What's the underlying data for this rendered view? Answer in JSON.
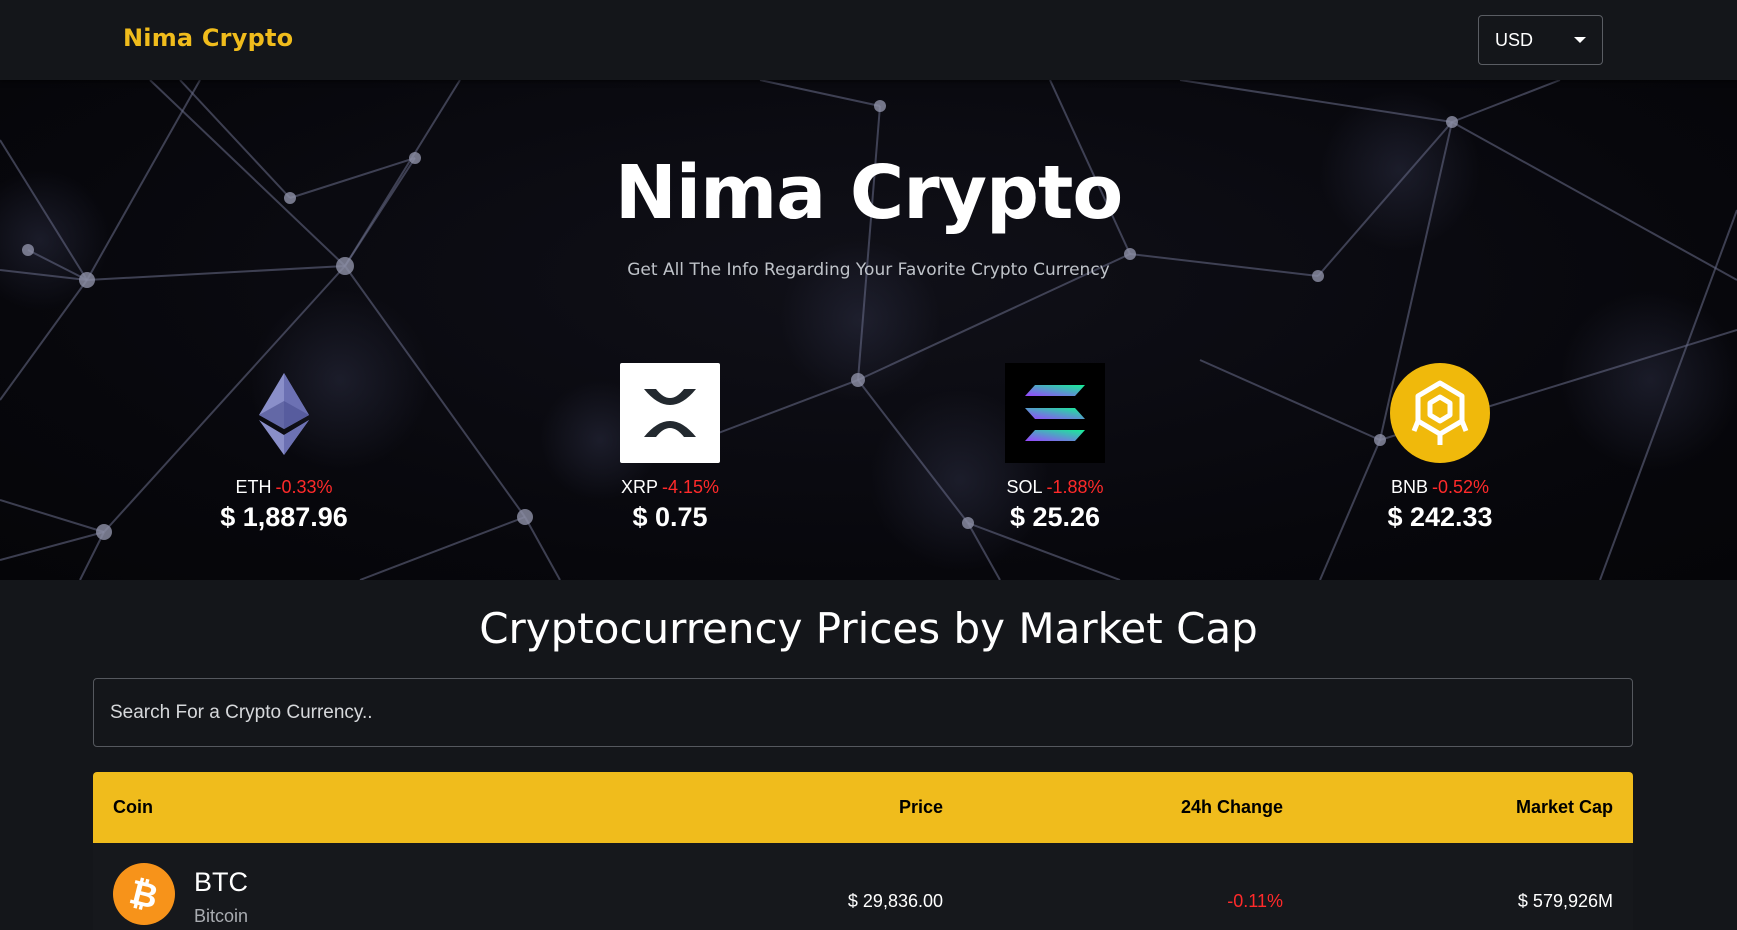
{
  "header": {
    "brand": "Nima Crypto",
    "currency": {
      "selected": "USD"
    }
  },
  "hero": {
    "title": "Nima Crypto",
    "subtitle": "Get All The Info Regarding Your Favorite Crypto Currency",
    "trending": [
      {
        "symbol": "ETH",
        "change": "-0.33%",
        "price": "$ 1,887.96",
        "icon": "ethereum-icon"
      },
      {
        "symbol": "XRP",
        "change": "-4.15%",
        "price": "$ 0.75",
        "icon": "xrp-icon"
      },
      {
        "symbol": "SOL",
        "change": "-1.88%",
        "price": "$ 25.26",
        "icon": "solana-icon"
      },
      {
        "symbol": "BNB",
        "change": "-0.52%",
        "price": "$ 242.33",
        "icon": "bnb-icon"
      }
    ]
  },
  "table": {
    "title": "Cryptocurrency Prices by Market Cap",
    "search_placeholder": "Search For a Crypto Currency..",
    "columns": {
      "coin": "Coin",
      "price": "Price",
      "change": "24h Change",
      "market_cap": "Market Cap"
    },
    "rows": [
      {
        "symbol": "BTC",
        "name": "Bitcoin",
        "price": "$ 29,836.00",
        "change": "-0.11%",
        "market_cap": "$ 579,926M",
        "icon": "bitcoin-icon"
      }
    ]
  },
  "colors": {
    "accent": "#f0bc1c",
    "negative": "#ff2a2a",
    "background": "#14161a"
  }
}
